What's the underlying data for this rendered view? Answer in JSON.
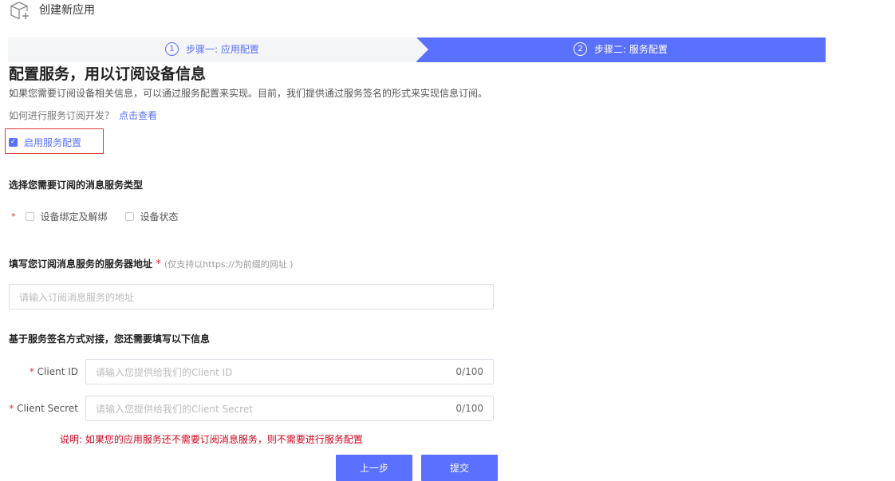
{
  "header": {
    "title": "创建新应用",
    "icon": "cube-add-icon"
  },
  "steps": [
    {
      "number": "1",
      "label": "步骤一: 应用配置",
      "active": false
    },
    {
      "number": "2",
      "label": "步骤二: 服务配置",
      "active": true
    }
  ],
  "main": {
    "heading": "配置服务，用以订阅设备信息",
    "description": "如果您需要订阅设备相关信息，可以通过服务配置来实现。目前，我们提供通过服务签名的形式来实现信息订阅。",
    "howto_text": "如何进行服务订阅开发？",
    "howto_link": "点击查看",
    "enable_service": {
      "label": "启用服务配置",
      "checked": true
    },
    "message_types": {
      "title": "选择您需要订阅的消息服务类型",
      "required_mark": "*",
      "options": [
        {
          "label": "设备绑定及解绑",
          "checked": false
        },
        {
          "label": "设备状态",
          "checked": false
        }
      ]
    },
    "server_address": {
      "title": "填写您订阅消息服务的服务器地址",
      "required_mark": "*",
      "note": "(仅支持以https://为前缀的网址 )",
      "placeholder": "请输入订阅消息服务的地址"
    },
    "signature": {
      "title": "基于服务签名方式对接，您还需要填写以下信息",
      "client_id": {
        "label": "Client ID",
        "required_mark": "*",
        "placeholder": "请输入您提供给我们的Client ID",
        "counter": "0/100"
      },
      "client_secret": {
        "label": "Client Secret",
        "required_mark": "*",
        "placeholder": "请输入您提供给我们的Client Secret",
        "counter": "0/100"
      }
    },
    "warning": "说明: 如果您的应用服务还不需要订阅消息服务，则不需要进行服务配置"
  },
  "buttons": {
    "prev": "上一步",
    "submit": "提交"
  },
  "colors": {
    "primary": "#5a70ff",
    "danger": "#e2383a",
    "step_inactive_bg": "#f4f5f7"
  }
}
